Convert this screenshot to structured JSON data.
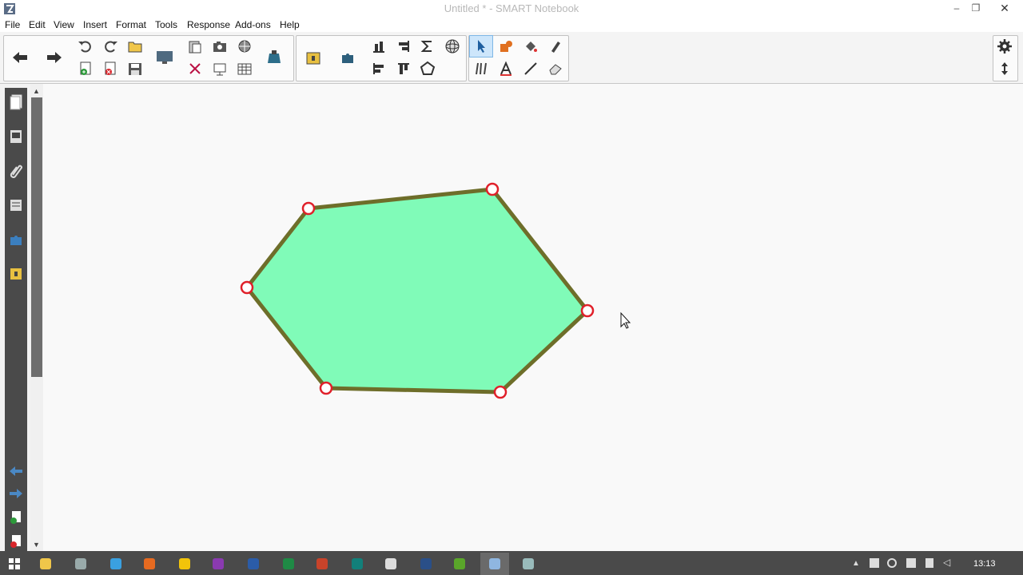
{
  "window": {
    "title": "Untitled * - SMART Notebook"
  },
  "menu": [
    "File",
    "Edit",
    "View",
    "Insert",
    "Format",
    "Tools",
    "Response",
    "Add-ons",
    "Help"
  ],
  "colors": {
    "shape_fill": "#80fbb8",
    "shape_stroke": "#6e6e2a",
    "handle": "#e0202a",
    "selected_tool": "#cde6fb"
  },
  "canvas": {
    "shape": {
      "type": "polygon",
      "vertices": 6,
      "selected": true
    }
  },
  "taskbar": {
    "icons": [
      "file-explorer-icon",
      "settings-icon",
      "ie-icon",
      "firefox-icon",
      "chrome-icon",
      "onenote-icon",
      "word-icon",
      "excel-icon",
      "powerpoint-icon",
      "publisher-icon",
      "inkscape-icon",
      "media-icon",
      "spotify-icon",
      "smart-notebook-icon",
      "network-tool-icon"
    ],
    "clock": "13:13"
  }
}
